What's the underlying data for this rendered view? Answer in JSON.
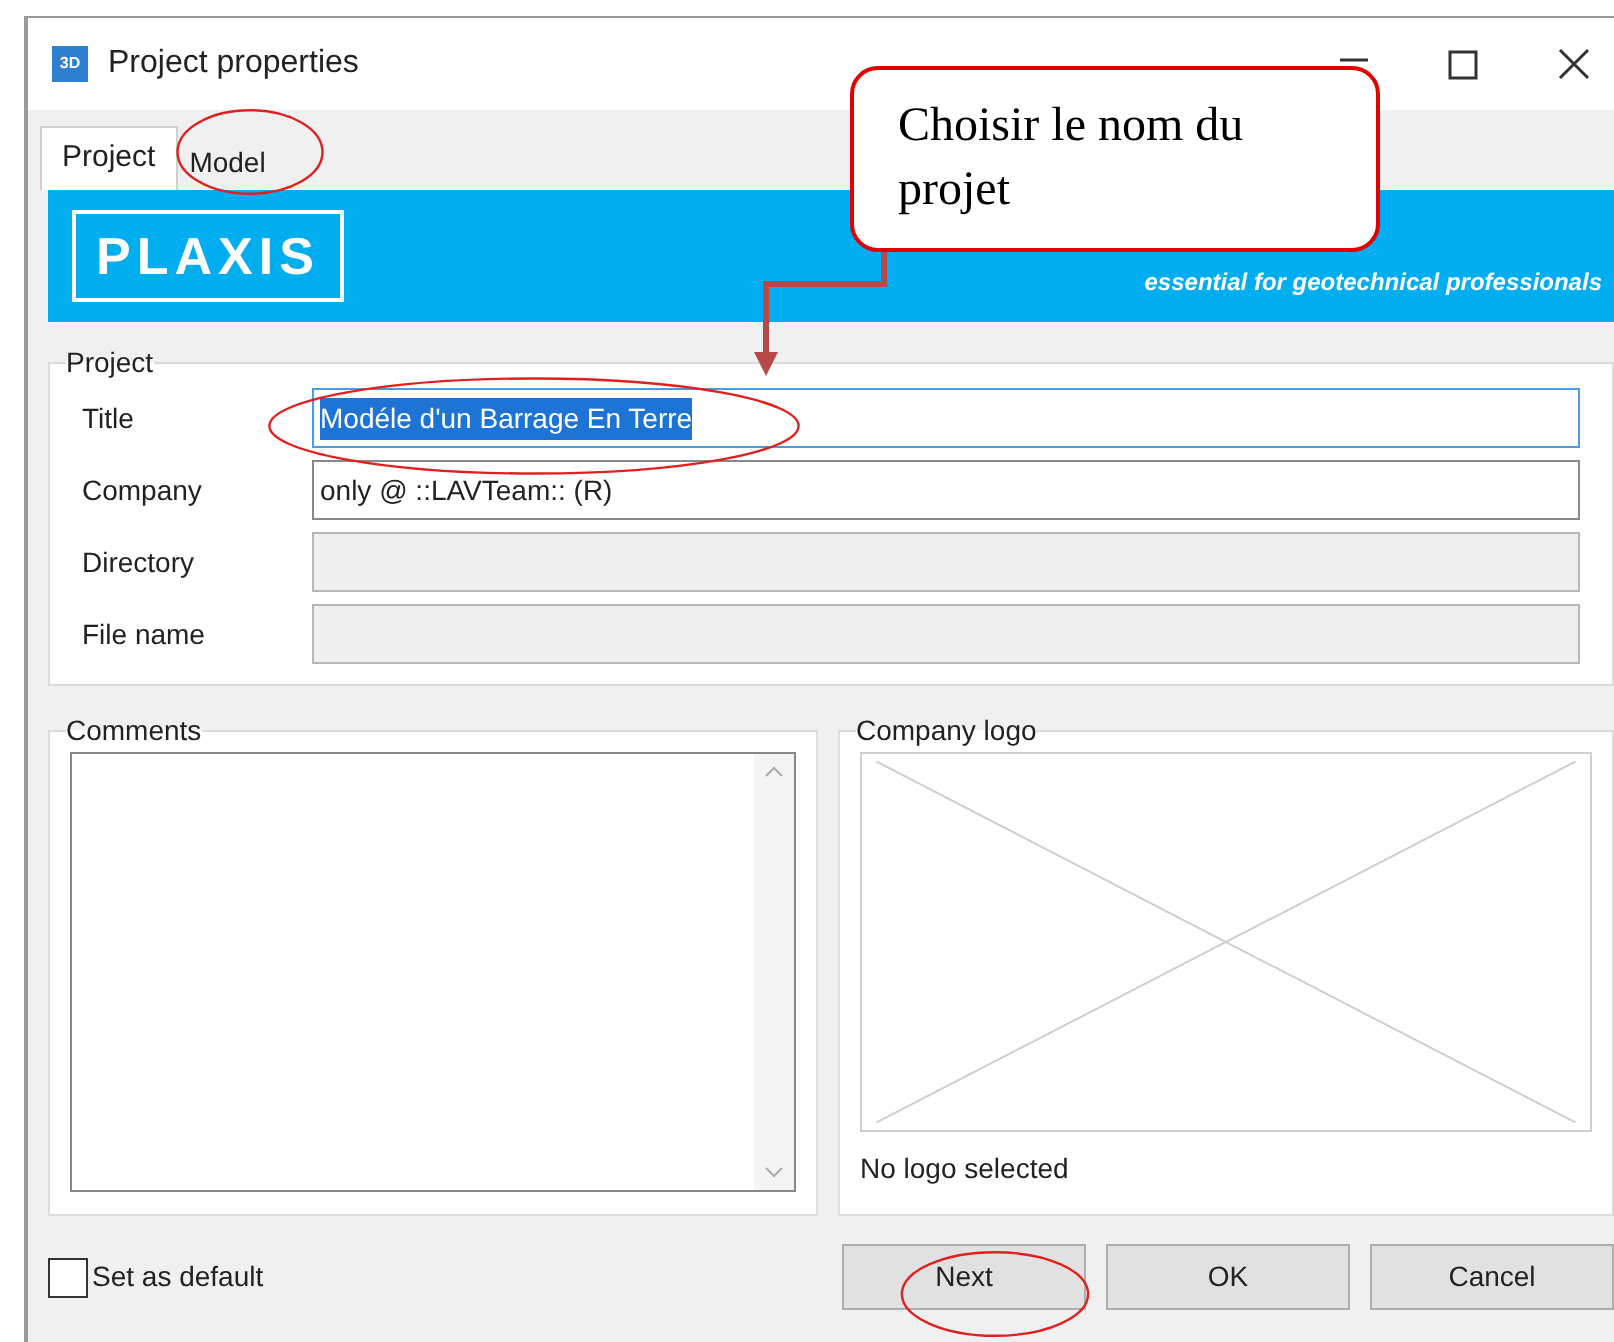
{
  "window": {
    "title": "Project properties",
    "app_icon": "3D"
  },
  "tabs": [
    {
      "label": "Project",
      "selected": true
    },
    {
      "label": "Model",
      "selected": false
    }
  ],
  "banner": {
    "logo": "PLAXIS",
    "tagline": "essential for geotechnical professionals"
  },
  "project_group": {
    "label": "Project",
    "fields": [
      {
        "label": "Title",
        "value": "Modéle d'un Barrage En Terre",
        "highlighted": true,
        "disabled": false
      },
      {
        "label": "Company",
        "value": "only @ ::LAVTeam:: (R)",
        "highlighted": false,
        "disabled": false
      },
      {
        "label": "Directory",
        "disabled": true
      },
      {
        "label": "File name",
        "disabled": true
      }
    ]
  },
  "comments": {
    "label": "Comments"
  },
  "company_logo": {
    "label": "Company logo",
    "status": "No logo selected"
  },
  "set_as_default": {
    "label": "Set as default",
    "checked": false
  },
  "buttons": [
    {
      "label": "Next"
    },
    {
      "label": "OK"
    },
    {
      "label": "Cancel"
    }
  ],
  "callout": {
    "text": "Choisir le nom du projet"
  }
}
